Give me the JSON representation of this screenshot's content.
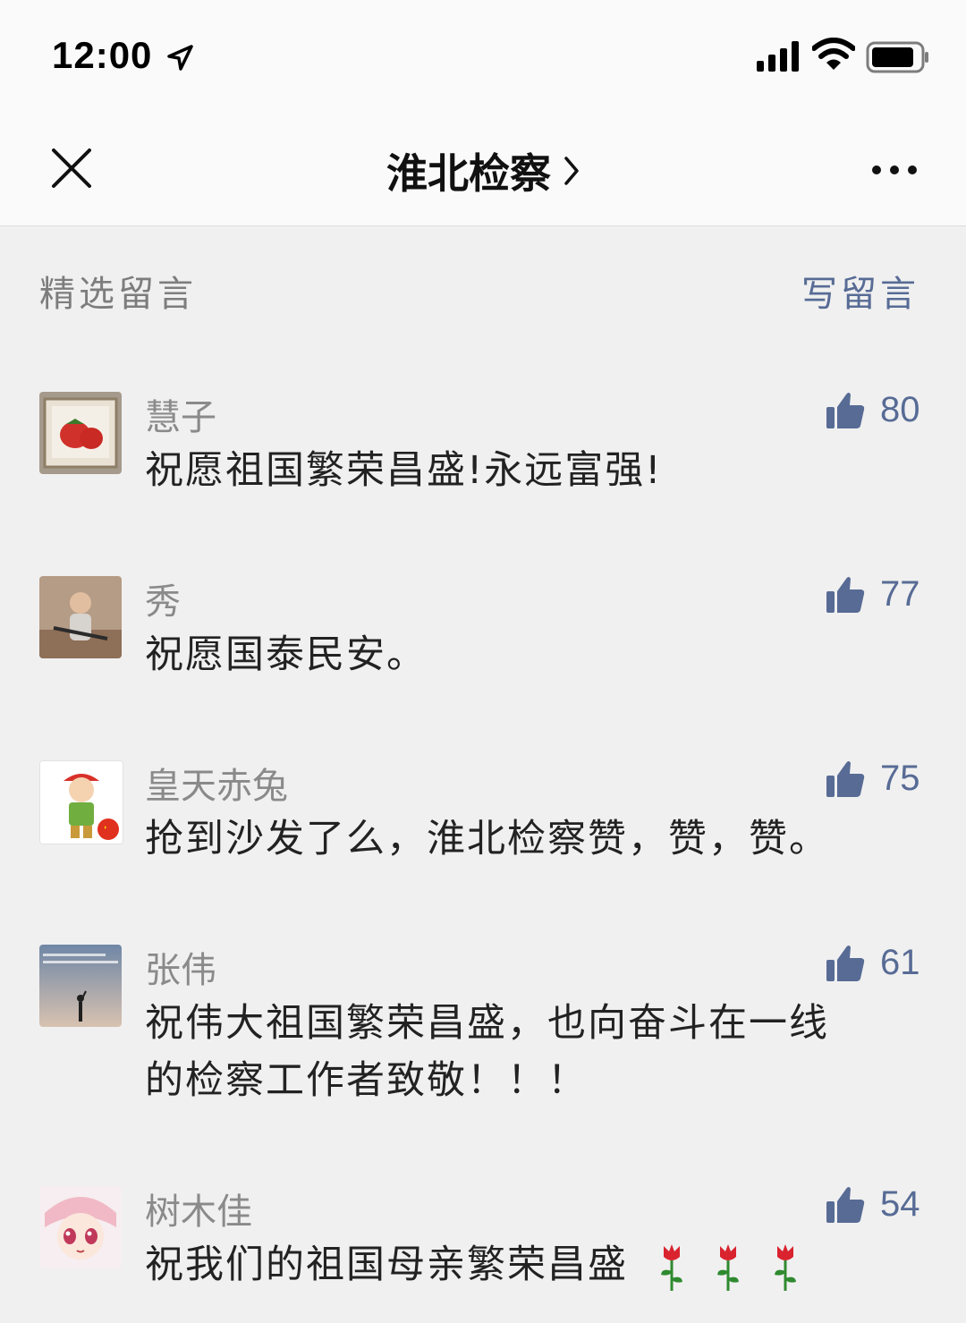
{
  "status": {
    "time": "12:00"
  },
  "header": {
    "title": "淮北检察"
  },
  "section": {
    "title": "精选留言",
    "write_label": "写留言"
  },
  "comments": [
    {
      "name": "慧子",
      "likes": "80",
      "text": "祝愿祖国繁荣昌盛!永远富强!"
    },
    {
      "name": "秀",
      "likes": "77",
      "text": "祝愿国泰民安。"
    },
    {
      "name": "皇天赤兔",
      "likes": "75",
      "text": "抢到沙发了么，淮北检察赞，赞，赞。"
    },
    {
      "name": "张伟",
      "likes": "61",
      "text_line1": "祝伟大祖国繁荣昌盛，也向奋斗在一线",
      "text_line2": "的检察工作者致敬！！！"
    },
    {
      "name": "树木佳",
      "likes": "54",
      "text": "祝我们的祖国母亲繁荣昌盛"
    }
  ],
  "colors": {
    "link": "#576b95",
    "name": "#8a8a8a",
    "background": "#f0f0f0"
  }
}
